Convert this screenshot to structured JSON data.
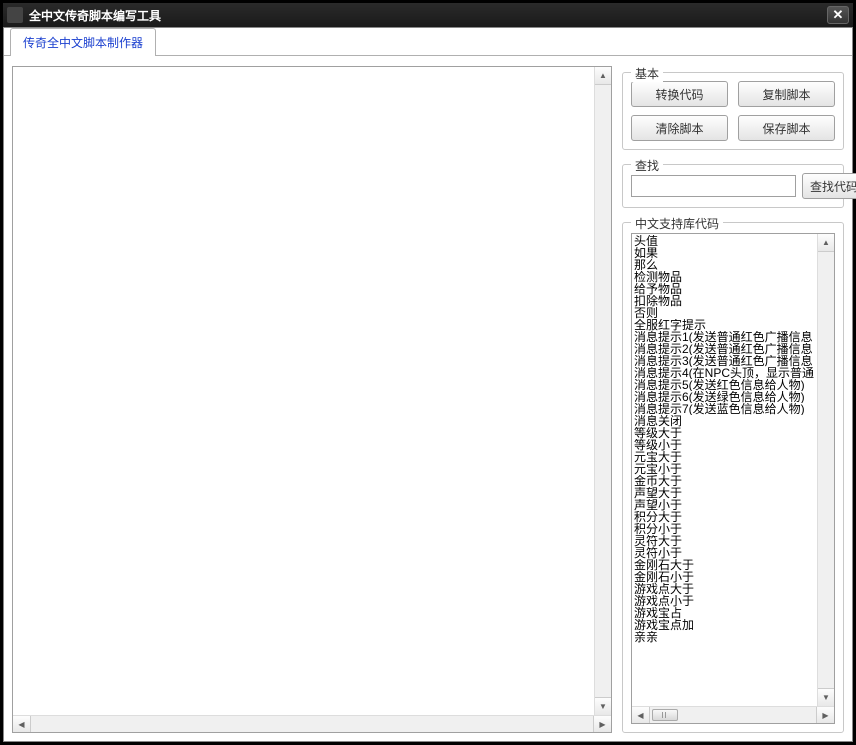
{
  "window": {
    "title": "全中文传奇脚本编写工具"
  },
  "tab": {
    "label": "传奇全中文脚本制作器"
  },
  "groups": {
    "basic_label": "基本",
    "search_label": "查找",
    "lib_label": "中文支持库代码"
  },
  "buttons": {
    "convert": "转换代码",
    "copy": "复制脚本",
    "clear": "清除脚本",
    "save": "保存脚本",
    "search": "查找代码"
  },
  "search": {
    "value": ""
  },
  "editor": {
    "value": ""
  },
  "lib_items": [
    "头值",
    "如果",
    "那么",
    "检测物品",
    "给予物品",
    "扣除物品",
    "否则",
    "全服红字提示",
    "消息提示1(发送普通红色广播信息",
    "消息提示2(发送普通红色广播信息",
    "消息提示3(发送普通红色广播信息",
    "消息提示4(在NPC头顶，显示普通",
    "消息提示5(发送红色信息给人物)",
    "消息提示6(发送绿色信息给人物)",
    "消息提示7(发送蓝色信息给人物)",
    "消息关闭",
    "等级大于",
    "等级小于",
    "元宝大于",
    "元宝小于",
    "金币大于",
    "声望大于",
    "声望小于",
    "积分大于",
    "积分小于",
    "灵符大于",
    "灵符小于",
    "金刚石大于",
    "金刚石小于",
    "游戏点大于",
    "游戏点小于",
    "游戏宝占",
    "游戏宝点加",
    "亲亲"
  ]
}
